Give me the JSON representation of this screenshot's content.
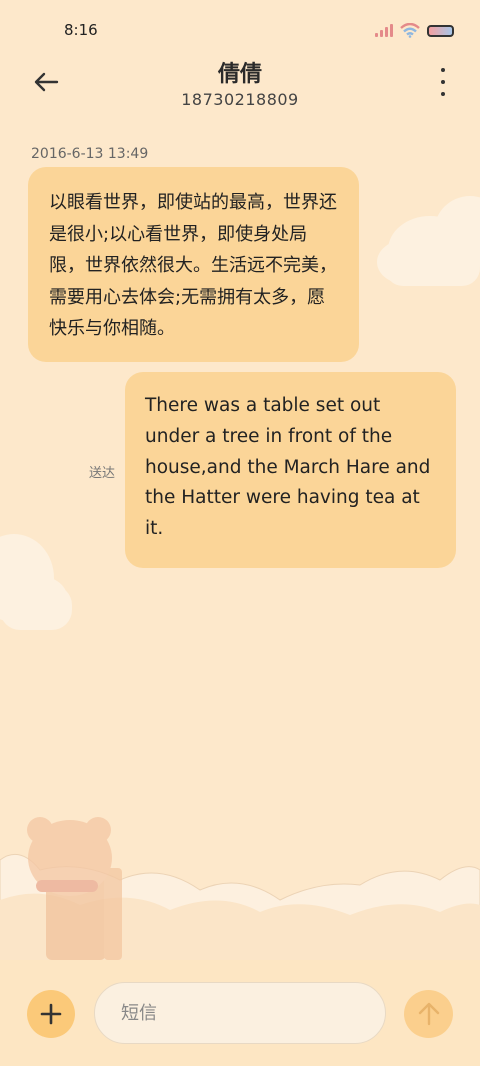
{
  "status_bar": {
    "time": "8:16",
    "icons": [
      "signal-icon",
      "wifi-icon",
      "battery-icon"
    ]
  },
  "header": {
    "contact_name": "倩倩",
    "phone_number": "18730218809",
    "icons": [
      "back-arrow-icon",
      "more-vertical-icon"
    ]
  },
  "conversation": {
    "timestamp": "2016-6-13 13:49",
    "messages": [
      {
        "direction": "incoming",
        "text": "以眼看世界，即使站的最高，世界还是很小;以心看世界，即使身处局限，世界依然很大。生活远不完美，需要用心去体会;无需拥有太多，愿快乐与你相随。"
      },
      {
        "direction": "outgoing",
        "text": "There was a table set out under a tree in front of the house,and the March Hare and the Hatter were having tea at it.",
        "status": "送达"
      }
    ]
  },
  "composer": {
    "placeholder": "短信",
    "value": "",
    "icons": [
      "plus-icon",
      "send-arrow-icon"
    ]
  },
  "colors": {
    "background": "#fde8cb",
    "bubble": "#fbd598",
    "add_button": "#fbc979",
    "send_button": "#fbcf8d"
  }
}
